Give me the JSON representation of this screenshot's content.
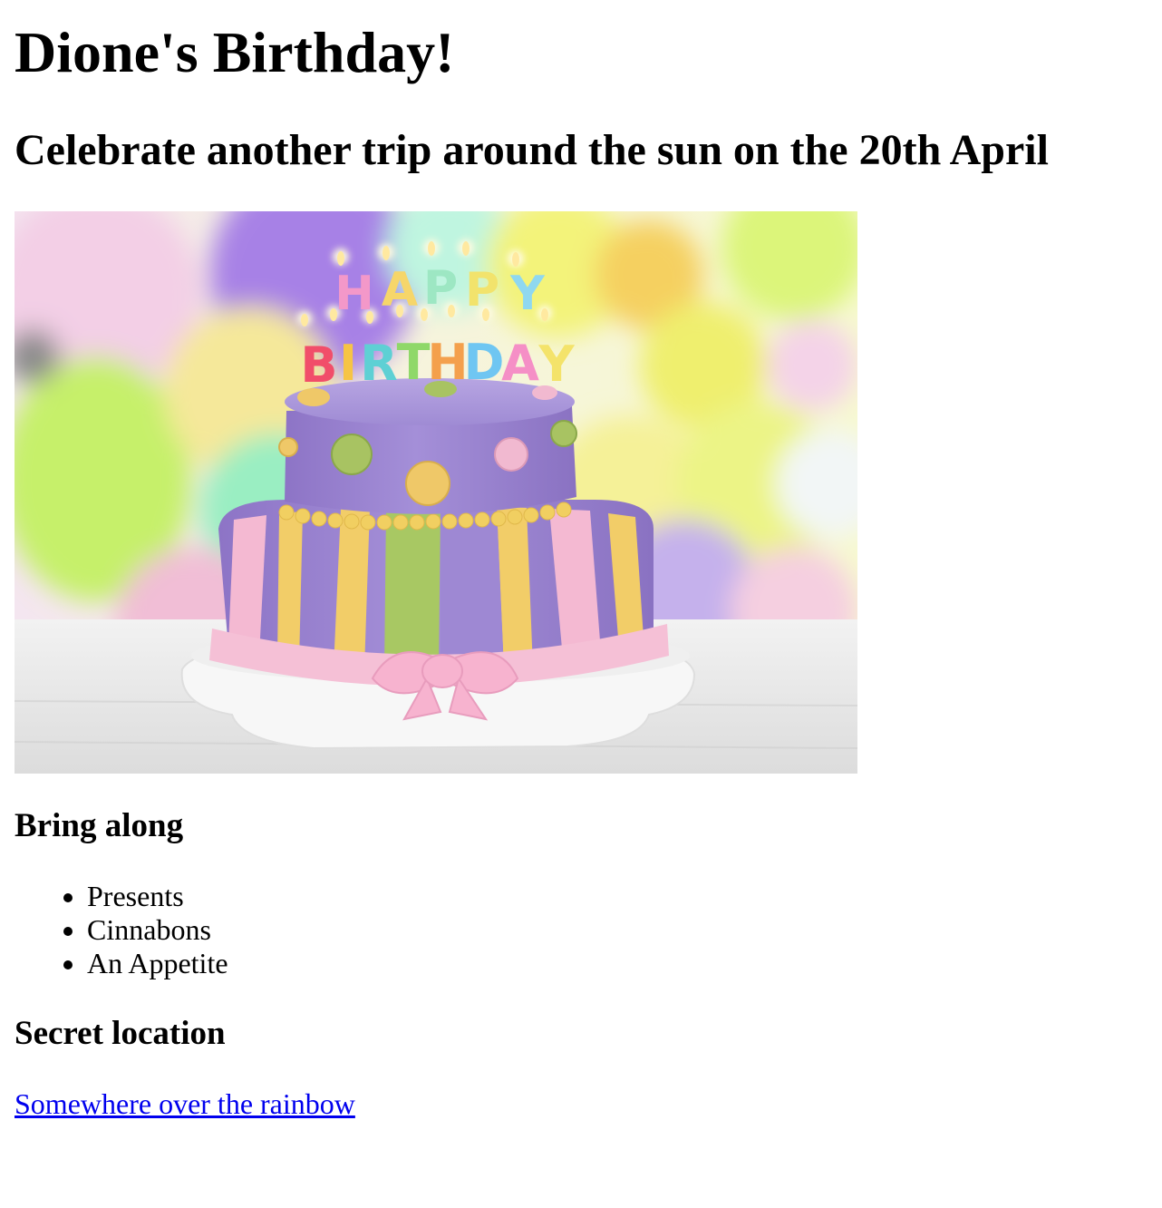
{
  "page": {
    "title": "Dione's Birthday!",
    "subtitle": "Celebrate another trip around the sun on the 20th April"
  },
  "hero_image": {
    "alt": "Two-tier birthday cake with HAPPY BIRTHDAY candles in front of pastel balloons",
    "cake_candles": {
      "line1": [
        "H",
        "A",
        "P",
        "P",
        "Y"
      ],
      "line2": [
        "B",
        "I",
        "R",
        "T",
        "H",
        "D",
        "A",
        "Y"
      ]
    }
  },
  "bring": {
    "heading": "Bring along",
    "items": [
      "Presents",
      "Cinnabons",
      "An Appetite"
    ]
  },
  "location": {
    "heading": "Secret location",
    "link_text": "Somewhere over the rainbow"
  },
  "colors": {
    "link": "#0000ee",
    "text": "#000000"
  }
}
